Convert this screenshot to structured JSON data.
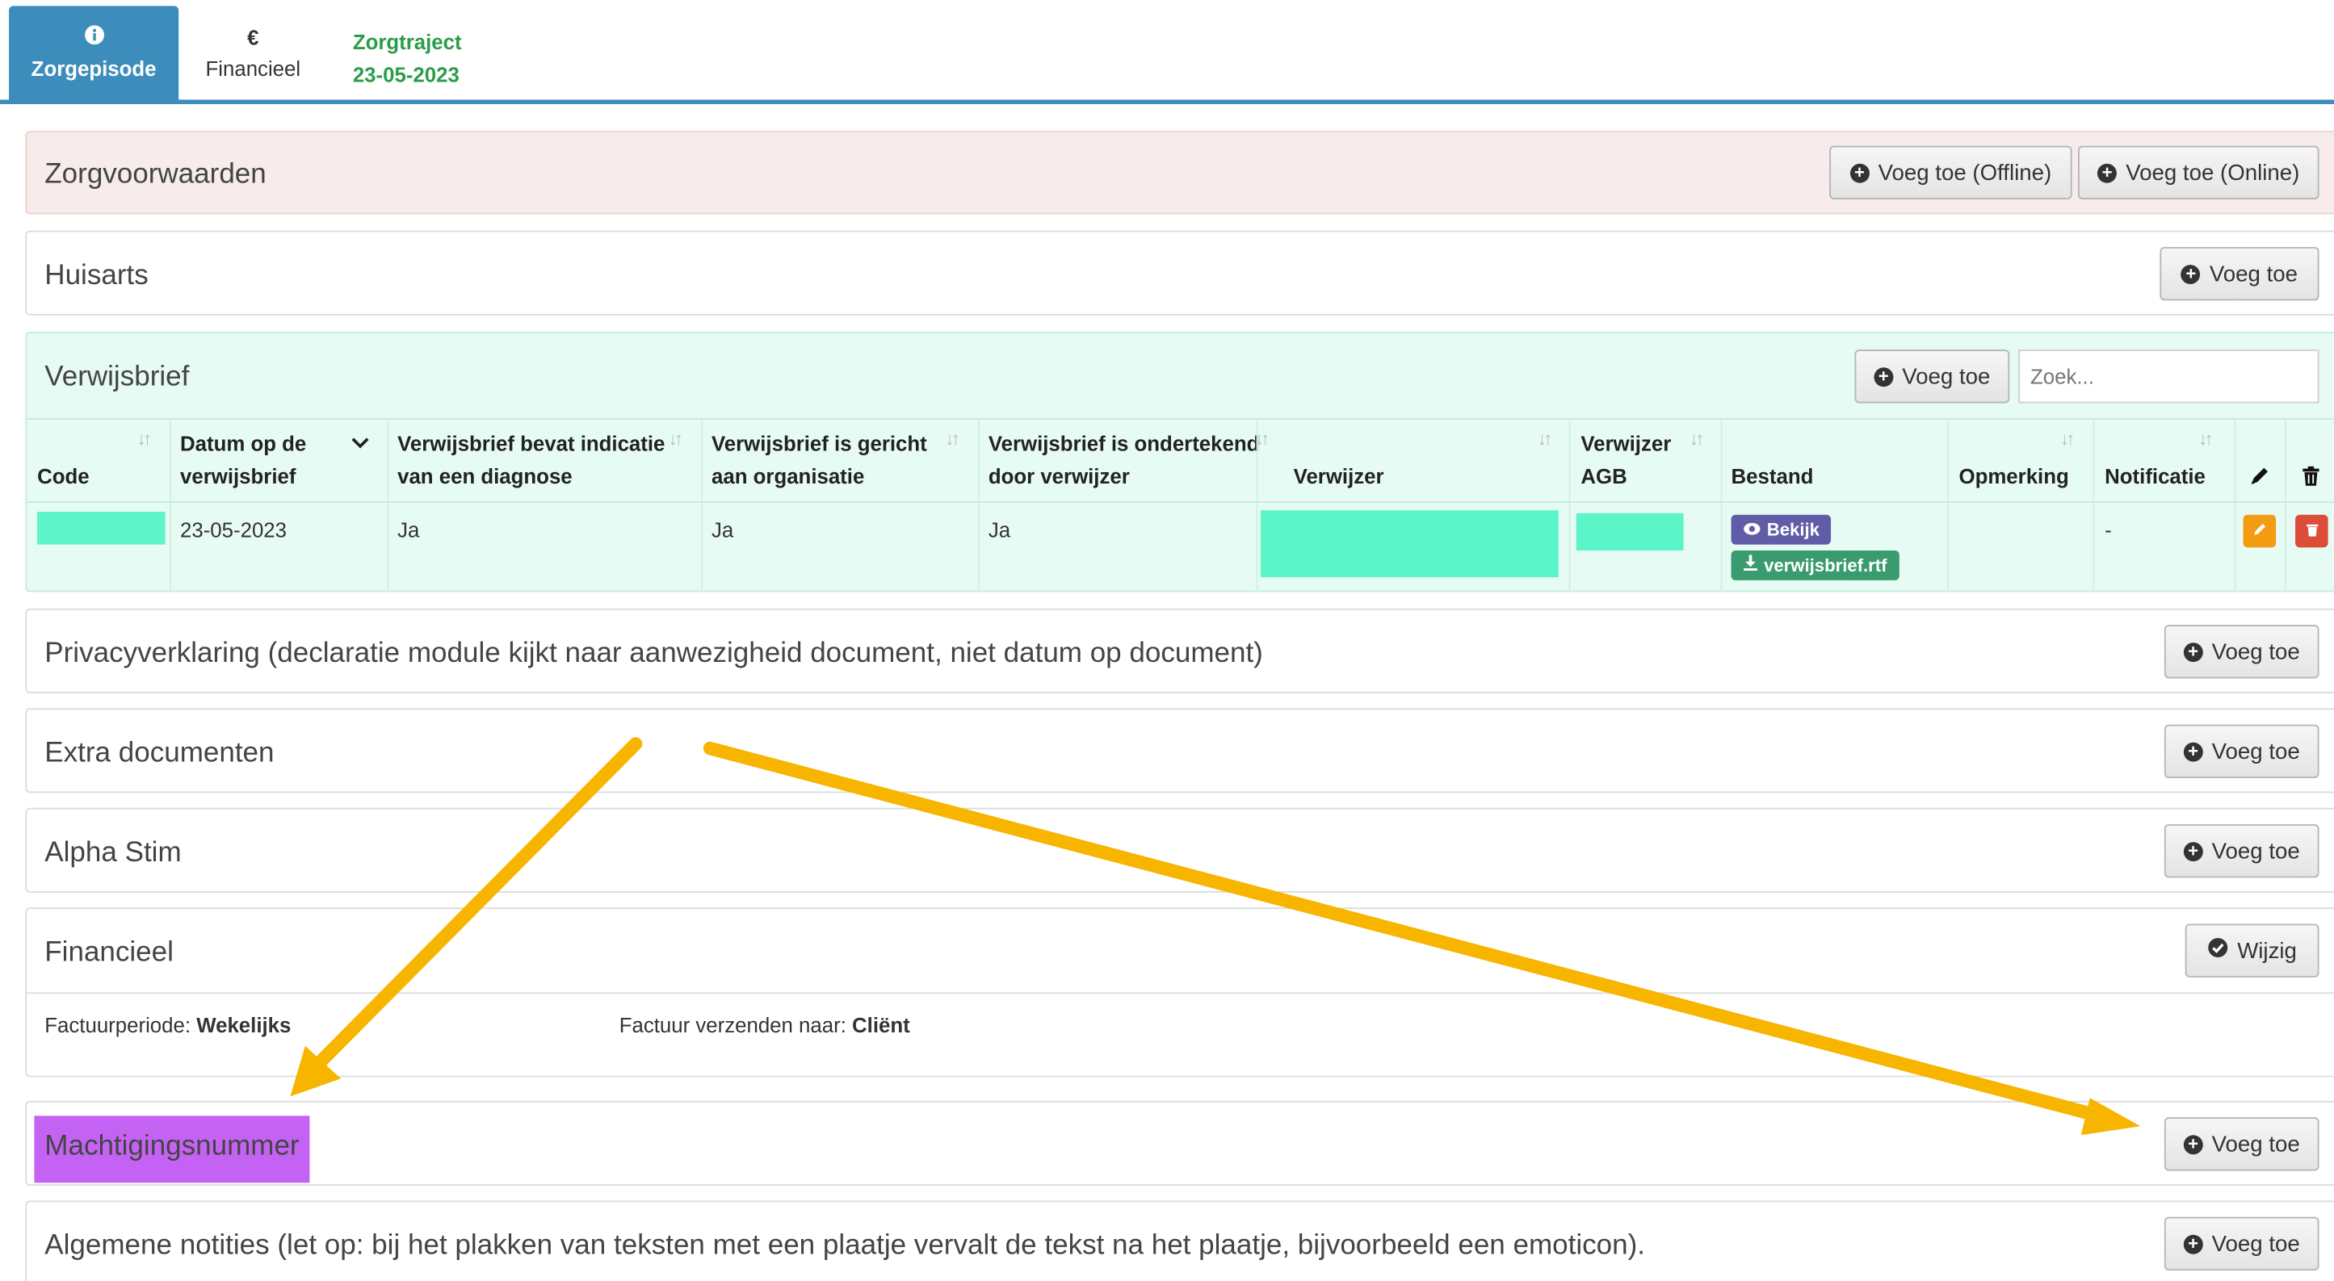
{
  "tabs": {
    "zorgepisode": {
      "icon": "info-icon",
      "label": "Zorgepisode"
    },
    "financieel": {
      "icon": "euro-icon",
      "symbol": "€",
      "label": "Financieel"
    },
    "zorgtraject": {
      "label": "Zorgtraject",
      "date": "23-05-2023"
    }
  },
  "panels": {
    "zorgvoorwaarden": {
      "title": "Zorgvoorwaarden",
      "btn_offline": "Voeg toe (Offline)",
      "btn_online": "Voeg toe (Online)"
    },
    "huisarts": {
      "title": "Huisarts",
      "btn": "Voeg toe"
    },
    "verwijsbrief": {
      "title": "Verwijsbrief",
      "btn": "Voeg toe",
      "search_placeholder": "Zoek...",
      "columns": {
        "code": "Code",
        "datum_l1": "Datum op de",
        "datum_l2": "verwijsbrief",
        "indicatie_l1": "Verwijsbrief bevat indicatie",
        "indicatie_l2": "van een diagnose",
        "gericht_l1": "Verwijsbrief is gericht",
        "gericht_l2": "aan organisatie",
        "ondertekend_l1": "Verwijsbrief is ondertekend",
        "ondertekend_l2": "door verwijzer",
        "verwijzer": "Verwijzer",
        "agb_l1": "Verwijzer",
        "agb_l2": "AGB",
        "bestand": "Bestand",
        "opmerking": "Opmerking",
        "notificatie": "Notificatie"
      },
      "row": {
        "datum": "23-05-2023",
        "indicatie": "Ja",
        "gericht": "Ja",
        "ondertekend": "Ja",
        "bekijk": "Bekijk",
        "file": "verwijsbrief.rtf",
        "notificatie": "-"
      }
    },
    "privacy": {
      "title": "Privacyverklaring (declaratie module kijkt naar aanwezigheid document, niet datum op document)",
      "btn": "Voeg toe"
    },
    "extra": {
      "title": "Extra documenten",
      "btn": "Voeg toe"
    },
    "alpha": {
      "title": "Alpha Stim",
      "btn": "Voeg toe"
    },
    "financieel": {
      "title": "Financieel",
      "btn": "Wijzig",
      "periode_label": "Factuurperiode:",
      "periode_value": "Wekelijks",
      "verzenden_label": "Factuur verzenden naar:",
      "verzenden_value": "Cliënt"
    },
    "machtiging": {
      "title": "Machtigingsnummer",
      "btn": "Voeg toe"
    },
    "notities": {
      "title": "Algemene notities (let op: bij het plakken van teksten met een plaatje vervalt de tekst na het plaatje, bijvoorbeeld een emoticon).",
      "btn": "Voeg toe"
    }
  },
  "colors": {
    "tab_active": "#3c8dbc",
    "zorgtraject": "#2a9d49",
    "arrow": "#f7b500",
    "highlight": "#c463f3",
    "redaction": "#5bf5c8",
    "bekijk_badge": "#605ca8",
    "file_badge": "#3a9b6f",
    "edit_button": "#f39c12",
    "delete_button": "#dd4b39"
  }
}
